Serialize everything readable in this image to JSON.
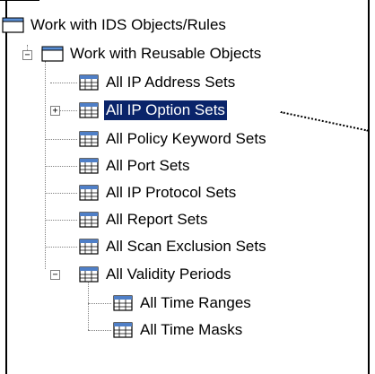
{
  "tree": {
    "root": {
      "label": "Work with IDS Objects/Rules"
    },
    "reusable": {
      "label": "Work with Reusable Objects"
    },
    "items": [
      {
        "label": "All IP Address Sets"
      },
      {
        "label": "All IP Option Sets"
      },
      {
        "label": "All Policy Keyword Sets"
      },
      {
        "label": "All Port Sets"
      },
      {
        "label": "All IP Protocol Sets"
      },
      {
        "label": "All Report Sets"
      },
      {
        "label": "All Scan Exclusion Sets"
      },
      {
        "label": "All Validity Periods"
      }
    ],
    "validity_children": [
      {
        "label": "All Time Ranges"
      },
      {
        "label": "All Time Masks"
      }
    ],
    "selected_item": "All IP Option Sets",
    "selection_color": "#0a246a"
  },
  "icons": {
    "folder": "folder-icon",
    "table": "table-icon",
    "expand": "+",
    "collapse": "−"
  }
}
